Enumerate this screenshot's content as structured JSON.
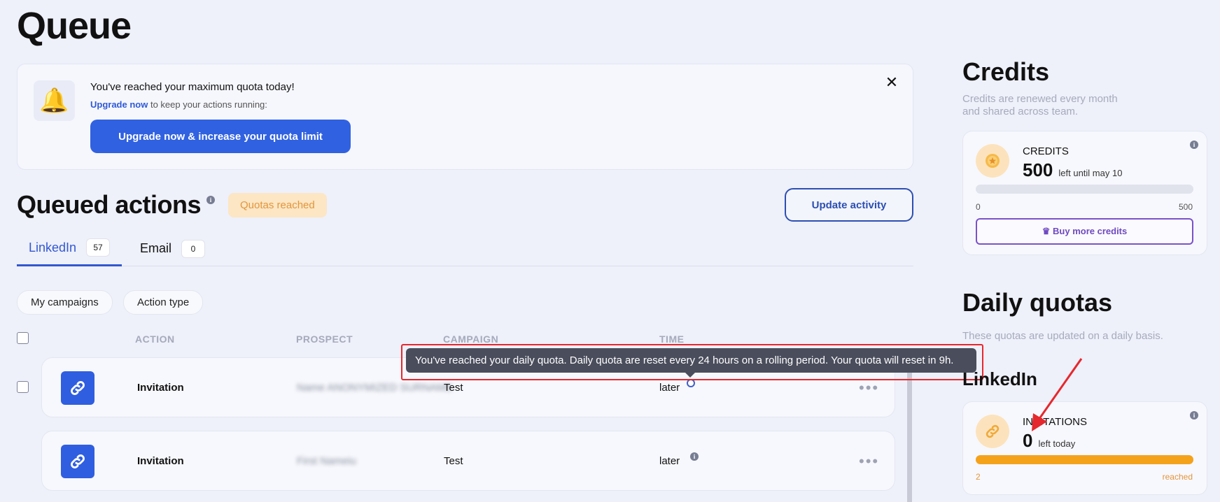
{
  "page": {
    "title": "Queue"
  },
  "banner": {
    "title": "You've reached your maximum quota today!",
    "sub_link": "Upgrade now",
    "sub_text": " to keep your actions running:",
    "cta_label": "Upgrade now & increase your quota limit",
    "close_glyph": "✕",
    "bell_glyph": "🔔"
  },
  "queued": {
    "title": "Queued actions",
    "badge": "Quotas reached",
    "update_label": "Update activity",
    "info_glyph": "i"
  },
  "tabs": [
    {
      "label": "LinkedIn",
      "count": "57",
      "active": true
    },
    {
      "label": "Email",
      "count": "0",
      "active": false
    }
  ],
  "filters": [
    "My campaigns",
    "Action type"
  ],
  "table": {
    "headers": [
      "ACTION",
      "PROSPECT",
      "CAMPAIGN",
      "TIME"
    ],
    "rows": [
      {
        "action": "Invitation",
        "prospect": "Name ANONYMIZED SURNAME",
        "campaign": "Test",
        "time": "later"
      },
      {
        "action": "Invitation",
        "prospect": "First Nameiu",
        "campaign": "Test",
        "time": "later"
      }
    ],
    "more_glyph": "•••"
  },
  "tooltip": {
    "text": "You've reached your daily quota. Daily quota are reset every 24 hours on a rolling period. Your quota will reset in 9h."
  },
  "credits": {
    "title": "Credits",
    "desc": "Credits are renewed every month and shared across team.",
    "card_label": "CREDITS",
    "value": "500",
    "value_sub": "left until may 10",
    "bar_min": "0",
    "bar_max": "500",
    "used_fraction": 0,
    "buy_label": "Buy more credits",
    "crown_glyph": "♛"
  },
  "daily_quotas": {
    "title": "Daily quotas",
    "desc": "These quotas are updated on a daily basis.",
    "linkedin_title": "LinkedIn",
    "card_label": "INVITATIONS",
    "value": "0",
    "value_sub": "left today",
    "bar_left": "2",
    "bar_right": "reached",
    "used_fraction": 1
  },
  "colors": {
    "accent": "#3061e1",
    "quota_orange": "#f5a21b",
    "annotation_red": "#e5282d"
  }
}
